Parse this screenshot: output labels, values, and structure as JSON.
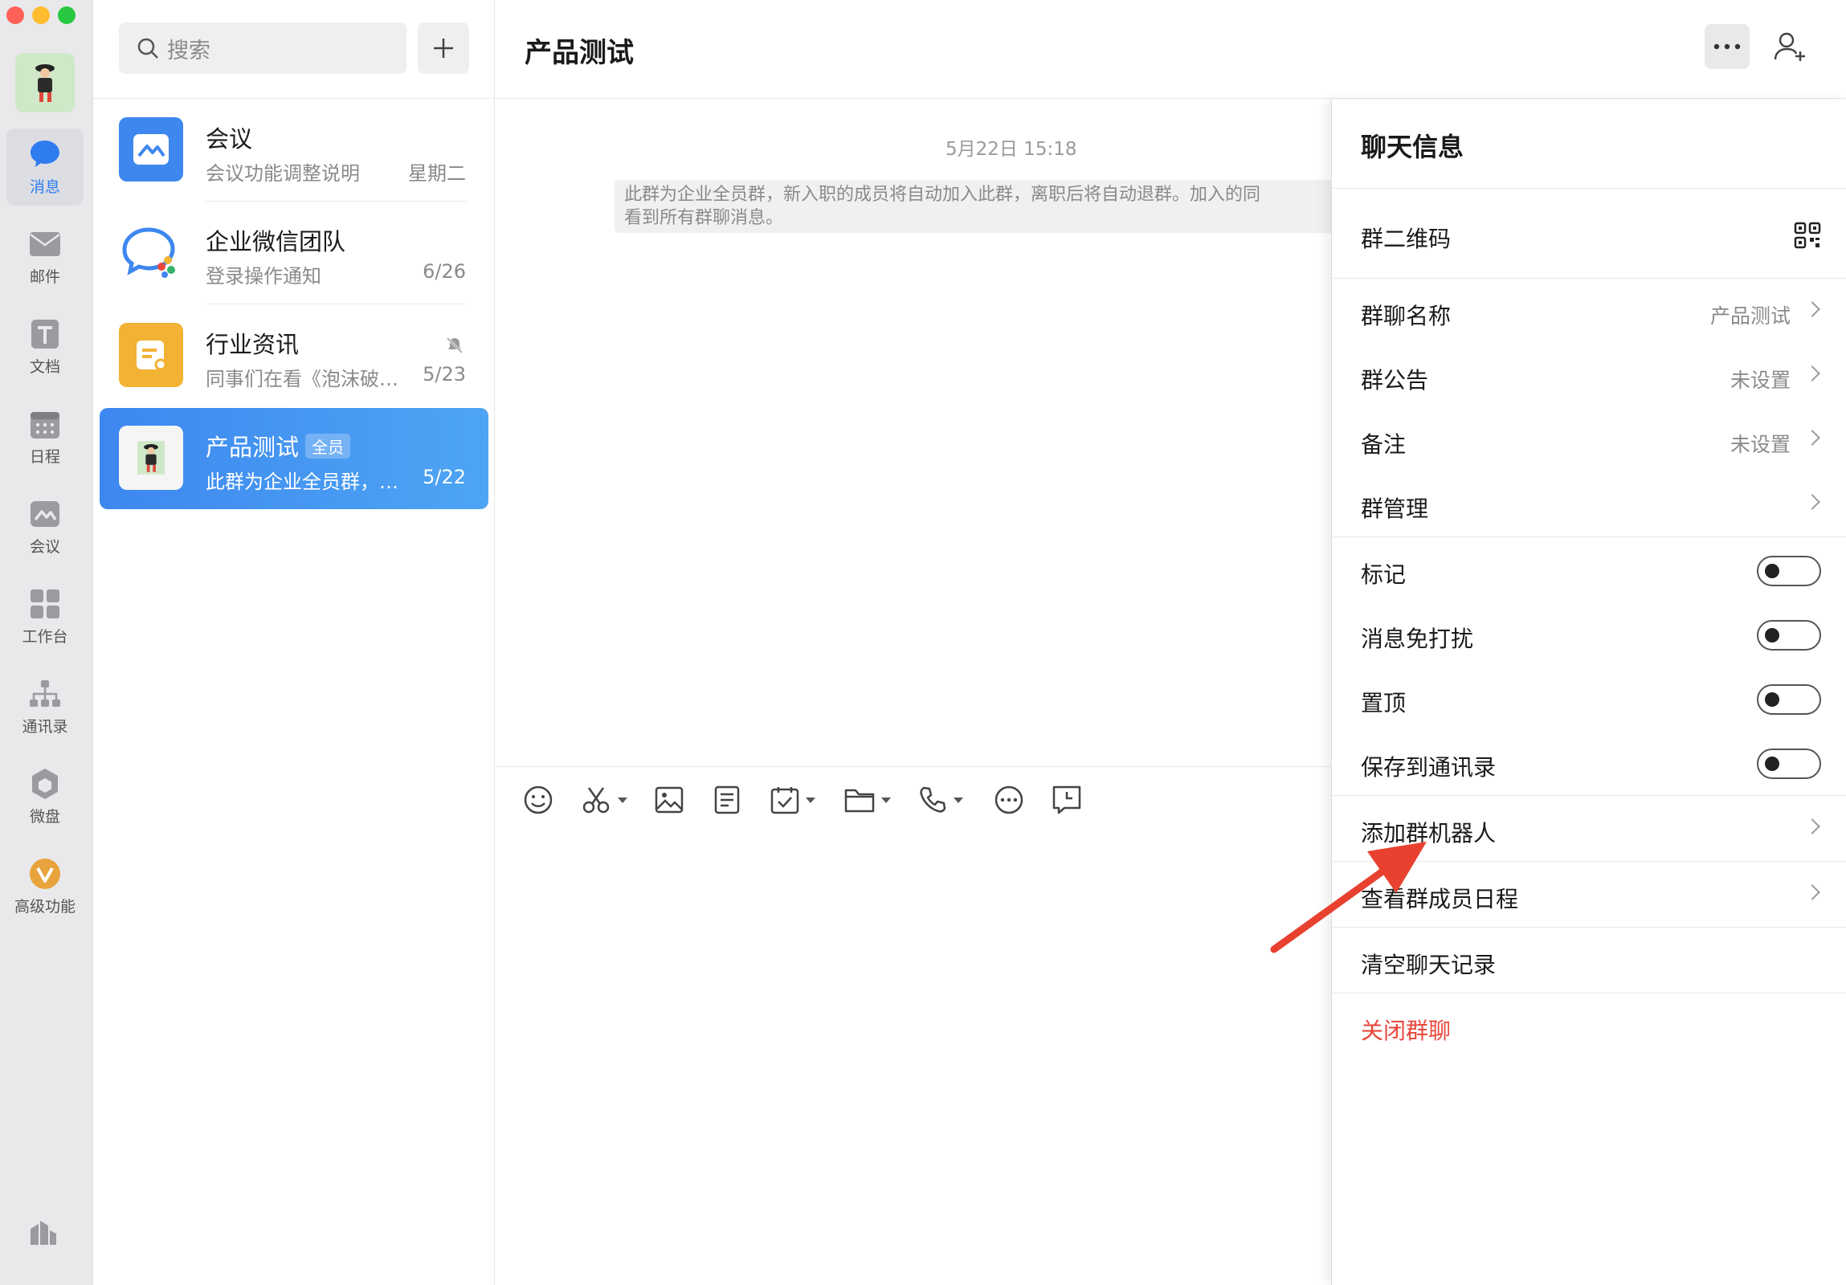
{
  "nav": {
    "items": [
      {
        "label": "消息",
        "icon": "chat-bubble-icon"
      },
      {
        "label": "邮件",
        "icon": "mail-icon"
      },
      {
        "label": "文档",
        "icon": "document-icon"
      },
      {
        "label": "日程",
        "icon": "calendar-icon"
      },
      {
        "label": "会议",
        "icon": "meeting-icon"
      },
      {
        "label": "工作台",
        "icon": "workbench-icon"
      },
      {
        "label": "通讯录",
        "icon": "contacts-icon"
      },
      {
        "label": "微盘",
        "icon": "drive-icon"
      },
      {
        "label": "高级功能",
        "icon": "premium-icon"
      }
    ]
  },
  "search": {
    "placeholder": "搜索"
  },
  "conversations": [
    {
      "name": "会议",
      "subtitle": "会议功能调整说明",
      "date": "星期二"
    },
    {
      "name": "企业微信团队",
      "subtitle": "登录操作通知",
      "date": "6/26"
    },
    {
      "name": "行业资讯",
      "subtitle": "同事们在看《泡沫破…",
      "date": "5/23"
    },
    {
      "name": "产品测试",
      "badge": "全员",
      "subtitle": "此群为企业全员群，…",
      "date": "5/22"
    }
  ],
  "chat": {
    "title": "产品测试",
    "timestamp": "5月22日 15:18",
    "system_message": "此群为企业全员群，新入职的成员将自动加入此群，离职后将自动退群。加入的同看到所有群聊消息。",
    "system_message_line1": "此群为企业全员群，新入职的成员将自动加入此群，离职后将自动退群。加入的同",
    "system_message_line2": "看到所有群聊消息。"
  },
  "panel": {
    "title": "聊天信息",
    "qr_label": "群二维码",
    "group_name_label": "群聊名称",
    "group_name_value": "产品测试",
    "announcement_label": "群公告",
    "announcement_value": "未设置",
    "remark_label": "备注",
    "remark_value": "未设置",
    "manage_label": "群管理",
    "mark_label": "标记",
    "mute_label": "消息免打扰",
    "pin_label": "置顶",
    "save_label": "保存到通讯录",
    "add_bot_label": "添加群机器人",
    "schedule_label": "查看群成员日程",
    "clear_label": "清空聊天记录",
    "close_label": "关闭群聊",
    "toggles": {
      "mark": false,
      "mute": false,
      "pin": false,
      "save": false
    }
  },
  "colors": {
    "accent": "#3d87ef",
    "danger": "#e8473c",
    "annotation_arrow": "#e8412f"
  }
}
